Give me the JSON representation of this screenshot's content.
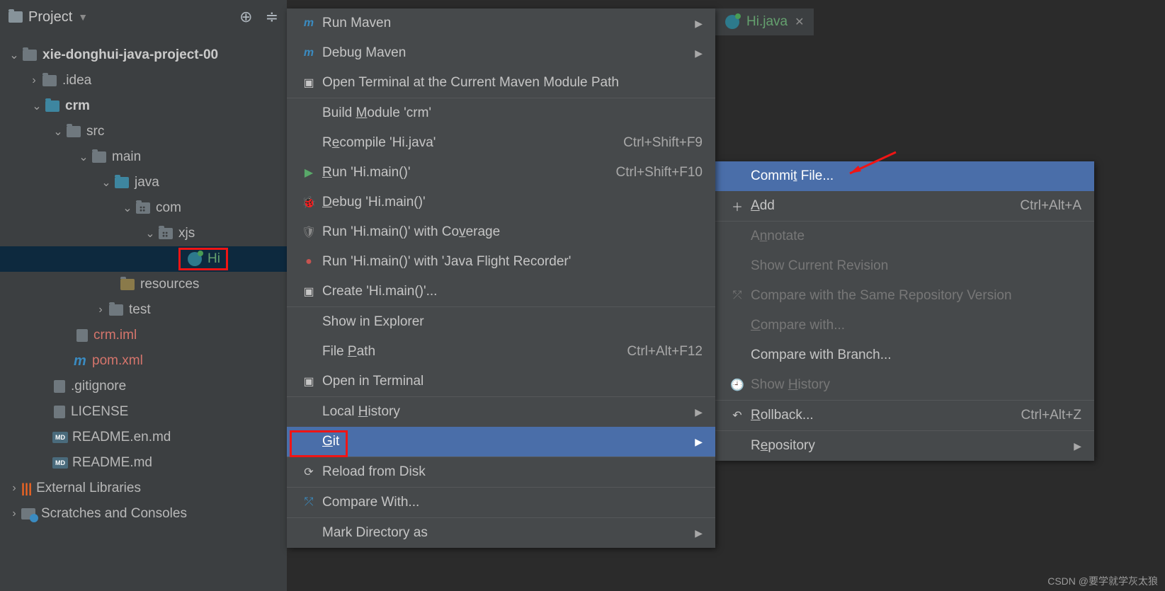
{
  "project_bar": {
    "label": "Project"
  },
  "tree": {
    "root": "xie-donghui-java-project-00",
    "idea": ".idea",
    "crm": "crm",
    "src": "src",
    "main": "main",
    "java": "java",
    "com": "com",
    "xjs": "xjs",
    "hi": "Hi",
    "resources": "resources",
    "test": "test",
    "crm_iml": "crm.iml",
    "pom": "pom.xml",
    "gitignore": ".gitignore",
    "license": "LICENSE",
    "readme_en": "README.en.md",
    "readme": "README.md",
    "ext_lib": "External Libraries",
    "scratches": "Scratches and Consoles"
  },
  "editor_tab": {
    "name": "Hi.java"
  },
  "menu1": {
    "run_maven": "Run Maven",
    "debug_maven": "Debug Maven",
    "open_terminal": "Open Terminal at the Current Maven Module Path",
    "build_module": "Build Module 'crm'",
    "recompile": "Recompile 'Hi.java'",
    "recompile_sc": "Ctrl+Shift+F9",
    "run": "Run 'Hi.main()'",
    "run_sc": "Ctrl+Shift+F10",
    "debug": "Debug 'Hi.main()'",
    "run_coverage": "Run 'Hi.main()' with Coverage",
    "run_jfr": "Run 'Hi.main()' with 'Java Flight Recorder'",
    "create": "Create 'Hi.main()'...",
    "show_explorer": "Show in Explorer",
    "file_path": "File Path",
    "file_path_sc": "Ctrl+Alt+F12",
    "open_terminal2": "Open in Terminal",
    "local_history": "Local History",
    "git": "Git",
    "reload": "Reload from Disk",
    "compare_with": "Compare With...",
    "mark_dir": "Mark Directory as"
  },
  "menu2": {
    "commit": "Commit File...",
    "add": "Add",
    "add_sc": "Ctrl+Alt+A",
    "annotate": "Annotate",
    "show_rev": "Show Current Revision",
    "compare_repo": "Compare with the Same Repository Version",
    "compare_with": "Compare with...",
    "compare_branch": "Compare with Branch...",
    "show_history": "Show History",
    "rollback": "Rollback...",
    "rollback_sc": "Ctrl+Alt+Z",
    "repository": "Repository"
  },
  "watermark": "CSDN @要学就学灰太狼"
}
